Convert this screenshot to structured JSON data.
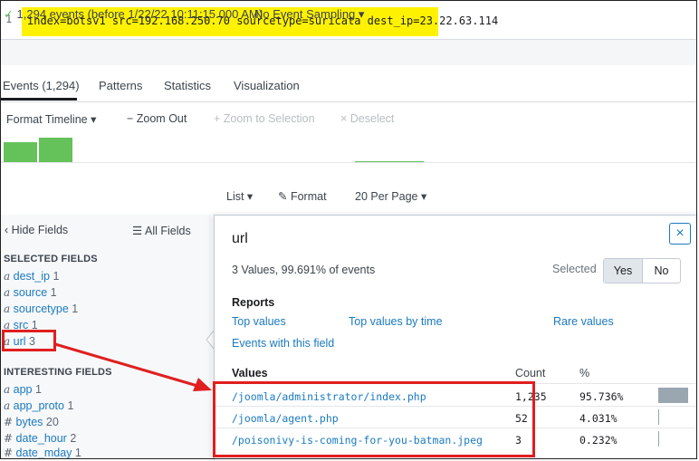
{
  "search": {
    "line_number": "1",
    "query": "index=botsv1 src=192.168.250.70 sourcetype=suricata dest_ip=23.22.63.114"
  },
  "status": {
    "check_mark": "✓",
    "events_text": "1,294 events (before 1/22/22 10:11:15.000 AM)",
    "sampling_label": "No Event Sampling ▾"
  },
  "tabs": [
    {
      "label": "Events (1,294)",
      "active": true
    },
    {
      "label": "Patterns"
    },
    {
      "label": "Statistics"
    },
    {
      "label": "Visualization"
    }
  ],
  "timeline": {
    "format_label": "Format Timeline ▾",
    "zoom_out_label": "− Zoom Out",
    "zoom_selection_label": "+ Zoom to Selection",
    "deselect_label": "× Deselect",
    "bar_color": "#65c15a"
  },
  "list_controls": {
    "list_label": "List ▾",
    "format_label": "Format",
    "per_page_label": "20 Per Page ▾"
  },
  "fields_panel": {
    "hide_fields_label": "Hide Fields",
    "all_fields_label": "All Fields",
    "selected_title": "SELECTED FIELDS",
    "selected": [
      {
        "type": "a",
        "name": "dest_ip",
        "count": "1"
      },
      {
        "type": "a",
        "name": "source",
        "count": "1"
      },
      {
        "type": "a",
        "name": "sourcetype",
        "count": "1"
      },
      {
        "type": "a",
        "name": "src",
        "count": "1"
      },
      {
        "type": "a",
        "name": "url",
        "count": "3"
      }
    ],
    "interesting_title": "INTERESTING FIELDS",
    "interesting": [
      {
        "type": "a",
        "name": "app",
        "count": "1"
      },
      {
        "type": "a",
        "name": "app_proto",
        "count": "1"
      },
      {
        "type": "#",
        "name": "bytes",
        "count": "20"
      },
      {
        "type": "#",
        "name": "date_hour",
        "count": "2"
      },
      {
        "type": "#",
        "name": "date_mday",
        "count": "1"
      }
    ]
  },
  "popup": {
    "title": "url",
    "close_icon": "×",
    "summary": "3 Values, 99.691% of events",
    "selected_label": "Selected",
    "yes_label": "Yes",
    "no_label": "No",
    "reports_title": "Reports",
    "links": {
      "top_values": "Top values",
      "top_values_by_time": "Top values by time",
      "rare_values": "Rare values",
      "events_with_field": "Events with this field"
    },
    "table_headers": {
      "values": "Values",
      "count": "Count",
      "percent": "%"
    },
    "rows": [
      {
        "value": "/joomla/administrator/index.php",
        "count": "1,235",
        "percent": "95.736%",
        "fraction": 0.95736
      },
      {
        "value": "/joomla/agent.php",
        "count": "52",
        "percent": "4.031%",
        "fraction": 0.04031
      },
      {
        "value": "/poisonivy-is-coming-for-you-batman.jpeg",
        "count": "3",
        "percent": "0.232%",
        "fraction": 0.00232
      }
    ]
  },
  "colors": {
    "highlight": "#fff200",
    "annotation": "#e01f1f",
    "link": "#1a7ac0"
  }
}
